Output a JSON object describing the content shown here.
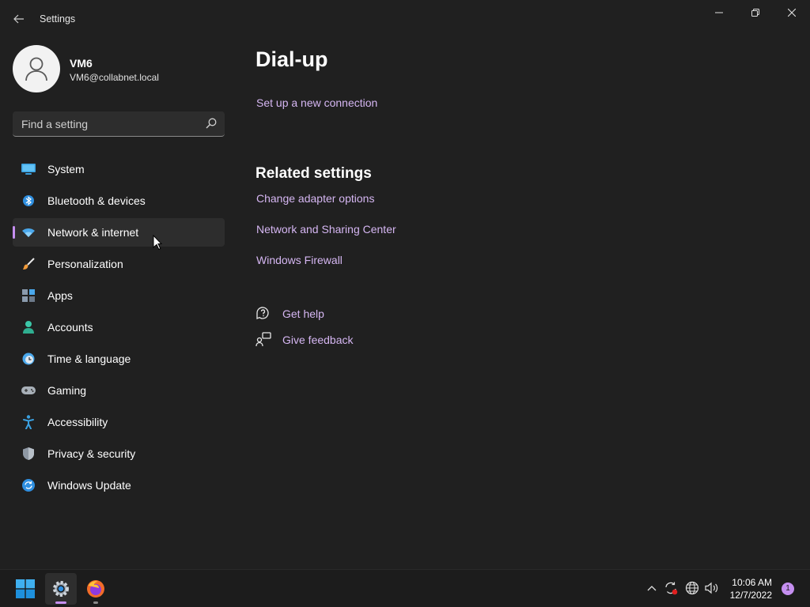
{
  "window": {
    "title": "Settings",
    "controls": [
      "minimize",
      "maximize",
      "close"
    ]
  },
  "profile": {
    "name": "VM6",
    "email": "VM6@collabnet.local"
  },
  "search": {
    "placeholder": "Find a setting"
  },
  "sidebar": {
    "items": [
      {
        "label": "System",
        "icon": "monitor-icon"
      },
      {
        "label": "Bluetooth & devices",
        "icon": "bluetooth-icon"
      },
      {
        "label": "Network & internet",
        "icon": "wifi-icon",
        "active": true
      },
      {
        "label": "Personalization",
        "icon": "brush-icon"
      },
      {
        "label": "Apps",
        "icon": "apps-icon"
      },
      {
        "label": "Accounts",
        "icon": "person-icon"
      },
      {
        "label": "Time & language",
        "icon": "clock-globe-icon"
      },
      {
        "label": "Gaming",
        "icon": "gamepad-icon"
      },
      {
        "label": "Accessibility",
        "icon": "accessibility-icon"
      },
      {
        "label": "Privacy & security",
        "icon": "shield-icon"
      },
      {
        "label": "Windows Update",
        "icon": "update-icon"
      }
    ]
  },
  "main": {
    "title": "Dial-up",
    "setup_link": "Set up a new connection",
    "related_title": "Related settings",
    "related_links": [
      "Change adapter options",
      "Network and Sharing Center",
      "Windows Firewall"
    ],
    "help": {
      "get_help": "Get help",
      "give_feedback": "Give feedback"
    }
  },
  "taskbar": {
    "apps": [
      "start-button",
      "settings-app",
      "firefox-app"
    ],
    "time": "10:06 AM",
    "date": "12/7/2022",
    "notification_count": "1"
  },
  "colors": {
    "background": "#202020",
    "accent": "#c58ff0",
    "link": "#d5b6f2",
    "sidebar_active": "#2d2d2d"
  }
}
